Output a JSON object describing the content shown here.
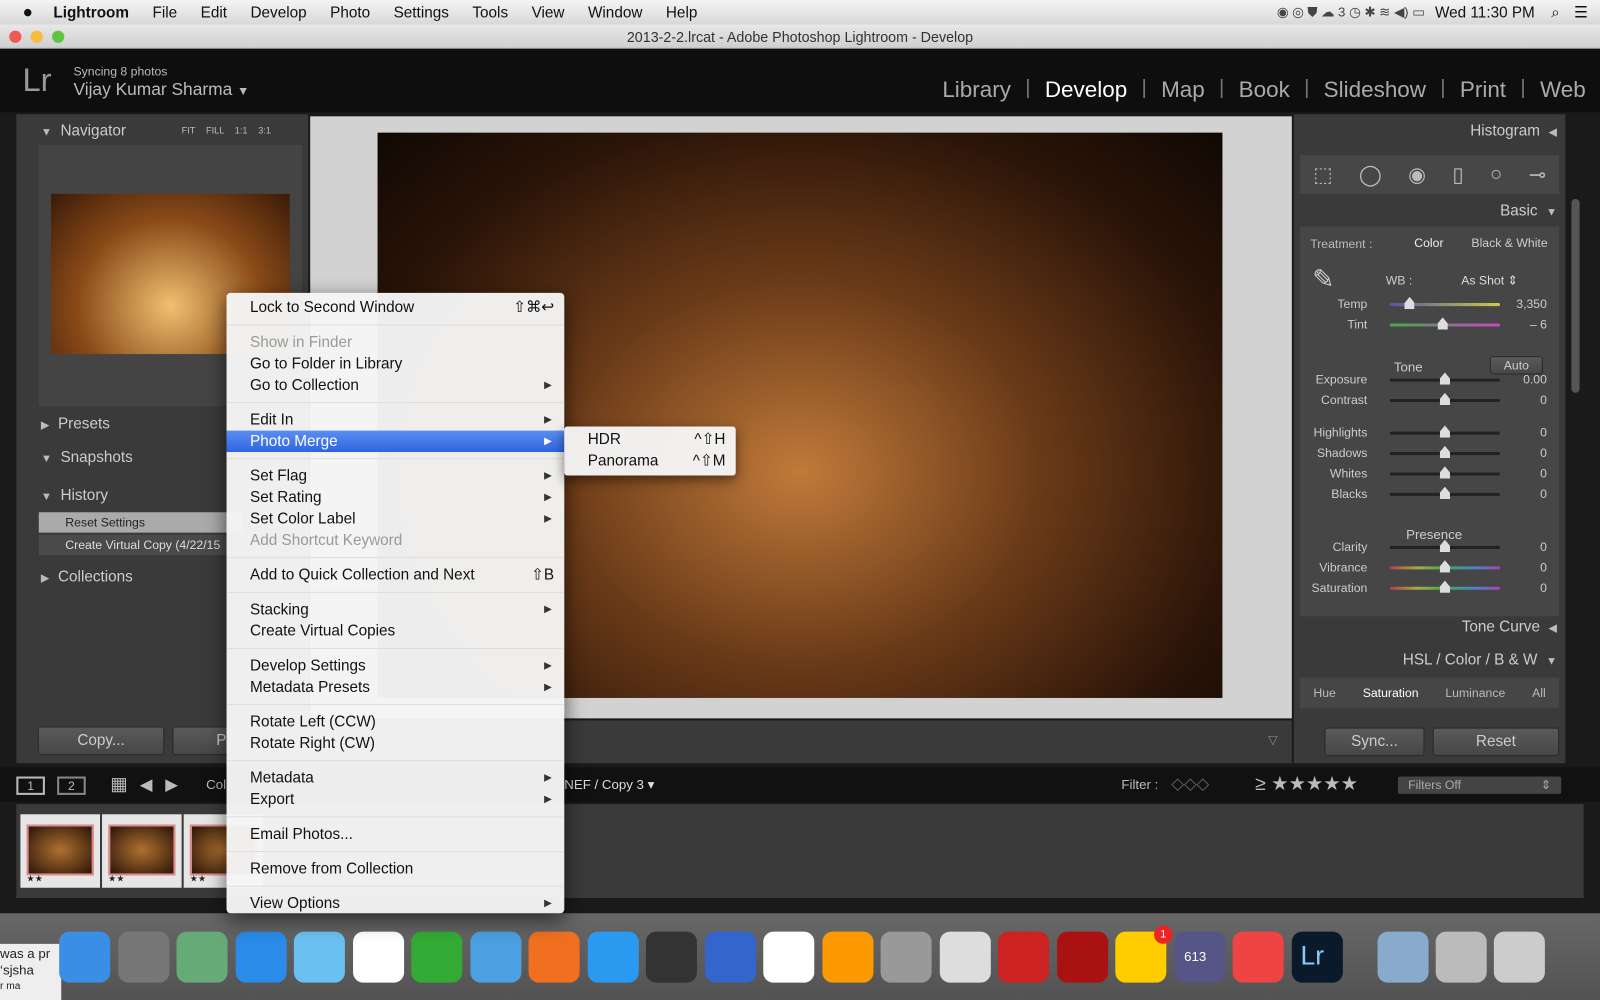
{
  "menubar": {
    "app": "Lightroom",
    "items": [
      "File",
      "Edit",
      "Develop",
      "Photo",
      "Settings",
      "Tools",
      "View",
      "Window",
      "Help"
    ],
    "cc_count": "3",
    "clock": "Wed 11:30 PM"
  },
  "window": {
    "title": "2013-2-2.lrcat - Adobe Photoshop Lightroom - Develop"
  },
  "identity": {
    "status": "Syncing 8 photos",
    "user": "Vijay Kumar Sharma",
    "logo": "Lr"
  },
  "modules": [
    "Library",
    "Develop",
    "Map",
    "Book",
    "Slideshow",
    "Print",
    "Web"
  ],
  "active_module": "Develop",
  "left": {
    "navigator": "Navigator",
    "zoom_opts": [
      "FIT",
      "FILL",
      "1:1",
      "3:1"
    ],
    "presets": "Presets",
    "snapshots": "Snapshots",
    "history": "History",
    "history_items": [
      "Reset Settings",
      "Create Virtual Copy (4/22/15"
    ],
    "collections": "Collections",
    "copy_btn": "Copy...",
    "paste_btn": "P"
  },
  "right": {
    "histogram": "Histogram",
    "basic": "Basic",
    "treatment_label": "Treatment :",
    "color": "Color",
    "bw": "Black & White",
    "wb_label": "WB :",
    "wb_value": "As Shot",
    "temp": {
      "label": "Temp",
      "value": "3,350",
      "pos": 0.18
    },
    "tint": {
      "label": "Tint",
      "value": "– 6",
      "pos": 0.48
    },
    "tone": "Tone",
    "auto": "Auto",
    "tone_sliders": [
      {
        "label": "Exposure",
        "value": "0.00"
      },
      {
        "label": "Contrast",
        "value": "0"
      }
    ],
    "tone_sliders2": [
      {
        "label": "Highlights",
        "value": "0"
      },
      {
        "label": "Shadows",
        "value": "0"
      },
      {
        "label": "Whites",
        "value": "0"
      },
      {
        "label": "Blacks",
        "value": "0"
      }
    ],
    "presence": "Presence",
    "presence_sliders": [
      {
        "label": "Clarity",
        "value": "0"
      },
      {
        "label": "Vibrance",
        "value": "0"
      },
      {
        "label": "Saturation",
        "value": "0"
      }
    ],
    "tone_curve": "Tone Curve",
    "hsl": "HSL",
    "hsl_color": "Color",
    "hsl_bw": "B & W",
    "hsl_tabs": [
      "Hue",
      "Saturation",
      "Luminance",
      "All"
    ],
    "sync": "Sync...",
    "reset": "Reset"
  },
  "filmstrip": {
    "pages": [
      "1",
      "2"
    ],
    "source_left": "Col",
    "source_right": "NEF / Copy 3",
    "filter_label": "Filter :",
    "rating_op": "≥",
    "stars": "★★★★★",
    "filter_value": "Filters Off",
    "thumb_ratings": [
      "★★",
      "★★",
      "★★"
    ]
  },
  "context_menu": {
    "sections": [
      [
        {
          "label": "Lock to Second Window",
          "shortcut": "⇧⌘↩"
        }
      ],
      [
        {
          "label": "Show in Finder",
          "disabled": true
        },
        {
          "label": "Go to Folder in Library"
        },
        {
          "label": "Go to Collection",
          "submenu": true
        }
      ],
      [
        {
          "label": "Edit In",
          "submenu": true
        },
        {
          "label": "Photo Merge",
          "submenu": true,
          "highlighted": true
        }
      ],
      [
        {
          "label": "Set Flag",
          "submenu": true
        },
        {
          "label": "Set Rating",
          "submenu": true
        },
        {
          "label": "Set Color Label",
          "submenu": true
        },
        {
          "label": "Add Shortcut Keyword",
          "disabled": true
        }
      ],
      [
        {
          "label": "Add to Quick Collection and Next",
          "shortcut": "⇧B"
        }
      ],
      [
        {
          "label": "Stacking",
          "submenu": true
        },
        {
          "label": "Create Virtual Copies"
        }
      ],
      [
        {
          "label": "Develop Settings",
          "submenu": true
        },
        {
          "label": "Metadata Presets",
          "submenu": true
        }
      ],
      [
        {
          "label": "Rotate Left (CCW)"
        },
        {
          "label": "Rotate Right (CW)"
        }
      ],
      [
        {
          "label": "Metadata",
          "submenu": true
        },
        {
          "label": "Export",
          "submenu": true
        }
      ],
      [
        {
          "label": "Email Photos..."
        }
      ],
      [
        {
          "label": "Remove from Collection"
        }
      ],
      [
        {
          "label": "View Options",
          "submenu": true
        }
      ]
    ]
  },
  "submenu": [
    {
      "label": "HDR",
      "shortcut": "^⇧H"
    },
    {
      "label": "Panorama",
      "shortcut": "^⇧M"
    }
  ],
  "behind_text": [
    "was a pr",
    "‘sjsha",
    "r ma"
  ],
  "dock": {
    "badges": {
      "opera": "1",
      "calendar": "613"
    },
    "lr_label": "Lr"
  }
}
